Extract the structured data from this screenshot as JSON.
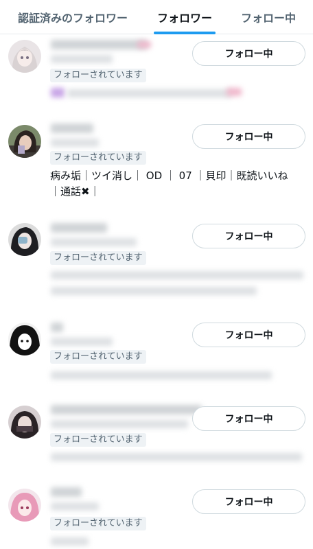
{
  "tabs": [
    {
      "label": "認証済みのフォロワー",
      "active": false
    },
    {
      "label": "フォロワー",
      "active": true
    },
    {
      "label": "フォロー中",
      "active": false
    }
  ],
  "accent_color": "#1d9bf0",
  "followers": [
    {
      "follows_you": "フォローされています",
      "button": "フォロー中",
      "bio": []
    },
    {
      "follows_you": "フォローされています",
      "button": "フォロー中",
      "bio": [
        "病み垢｜ツイ消し｜ OD ｜ 07 ｜貝印｜既読いいね",
        "｜通話✖︎｜"
      ]
    },
    {
      "follows_you": "フォローされています",
      "button": "フォロー中",
      "bio": []
    },
    {
      "follows_you": "フォローされています",
      "button": "フォロー中",
      "bio": []
    },
    {
      "follows_you": "フォローされています",
      "button": "フォロー中",
      "bio": []
    },
    {
      "follows_you": "フォローされています",
      "button": "フォロー中",
      "bio": []
    }
  ]
}
